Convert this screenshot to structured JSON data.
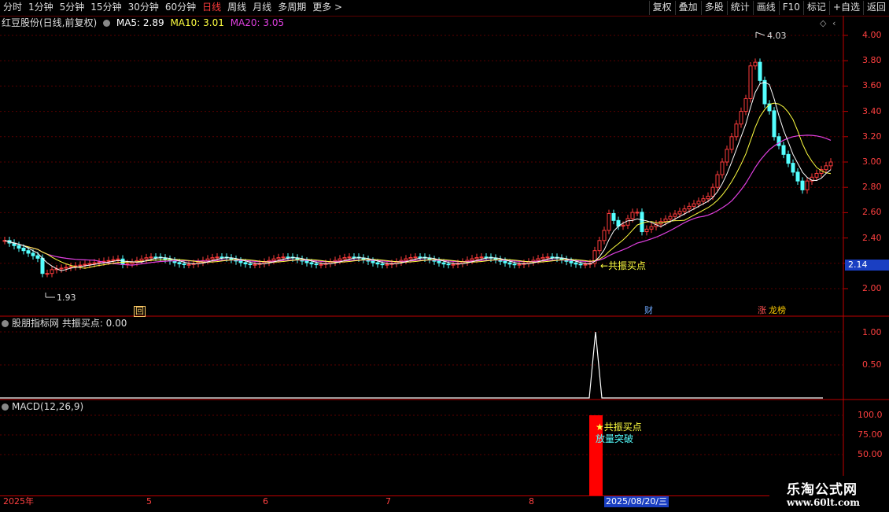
{
  "toolbar": {
    "periods": [
      "分时",
      "1分钟",
      "5分钟",
      "15分钟",
      "30分钟",
      "60分钟",
      "日线",
      "周线",
      "月线",
      "多周期",
      "更多 >"
    ],
    "active_period": "日线",
    "buttons": [
      "复权",
      "叠加",
      "多股",
      "统计",
      "画线",
      "F10",
      "标记",
      "+自选",
      "返回"
    ]
  },
  "main_chart": {
    "stock_title": "红豆股份(日线,前复权)",
    "ma5_label": "MA5: 2.89",
    "ma10_label": "MA10: 3.01",
    "ma20_label": "MA20: 3.05",
    "high_marker": "4.03",
    "low_marker": "1.93",
    "signal_label": "←共振买点",
    "current_price": "2.14",
    "badge_hui": "回",
    "badge_cai": "财",
    "badge_zhang": "涨",
    "badge_longhu": "龙榜",
    "y_ticks": [
      "4.00",
      "3.80",
      "3.60",
      "3.40",
      "3.20",
      "3.00",
      "2.80",
      "2.60",
      "2.40",
      "2.20",
      "2.00"
    ]
  },
  "indicator1": {
    "title": "股朋指标网 共振买点: 0.00",
    "y_ticks": [
      "1.00",
      "0.50"
    ]
  },
  "indicator2": {
    "title": "MACD(12,26,9)",
    "annotation_1": "★共振买点",
    "annotation_2": "放量突破",
    "y_ticks": [
      "100.0",
      "75.00",
      "50.00"
    ]
  },
  "x_axis": {
    "labels": [
      "2025年",
      "5",
      "6",
      "7",
      "8"
    ],
    "cursor_date": "2025/08/20/三"
  },
  "watermark": {
    "line1": "乐淘公式网",
    "line2": "www.60lt.com"
  },
  "colors": {
    "up": "#ff3b3b",
    "down": "#54ffff",
    "ma5": "#ffffff",
    "ma10": "#ffff40",
    "ma20": "#e040e0",
    "axis_red": "#ff4040",
    "signal_bar": "#ff0000"
  },
  "chart_data": {
    "type": "candlestick",
    "title": "红豆股份(日线,前复权)",
    "y_range": [
      1.85,
      4.1
    ],
    "ma_series": [
      "MA5",
      "MA10",
      "MA20"
    ],
    "high": 4.03,
    "low": 1.93,
    "last": 2.14,
    "signal_value": 1.0
  }
}
